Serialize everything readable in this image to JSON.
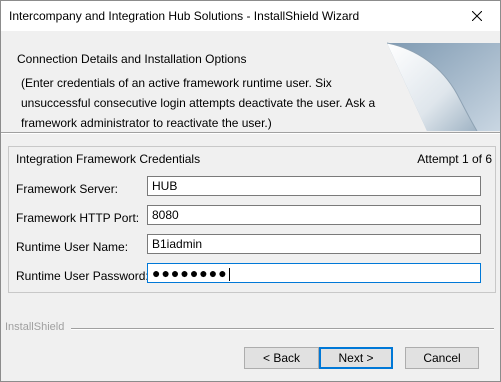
{
  "window": {
    "title": "Intercompany and Integration Hub Solutions - InstallShield Wizard",
    "close_icon": "close-icon"
  },
  "banner": {
    "title": "Connection Details and Installation Options",
    "description": "(Enter credentials of an active framework runtime user. Six unsuccessful consecutive login attempts deactivate the user. Ask a framework administrator to reactivate the user.)",
    "art_icon": "page-curl-graphic"
  },
  "credentials": {
    "group_title": "Integration Framework Credentials",
    "attempt": "Attempt 1 of 6",
    "fields": [
      {
        "label": "Framework Server:",
        "value": "HUB"
      },
      {
        "label": "Framework HTTP Port:",
        "value": "8080"
      },
      {
        "label": "Runtime User Name:",
        "value": "B1iadmin"
      },
      {
        "label": "Runtime User Password:",
        "value": "●●●●●●●●"
      }
    ]
  },
  "footer": {
    "brand": "InstallShield",
    "back_label": "< Back",
    "next_label": "Next >",
    "cancel_label": "Cancel"
  },
  "colors": {
    "focus_border": "#0078d7",
    "window_bg": "#f0f0f0"
  }
}
